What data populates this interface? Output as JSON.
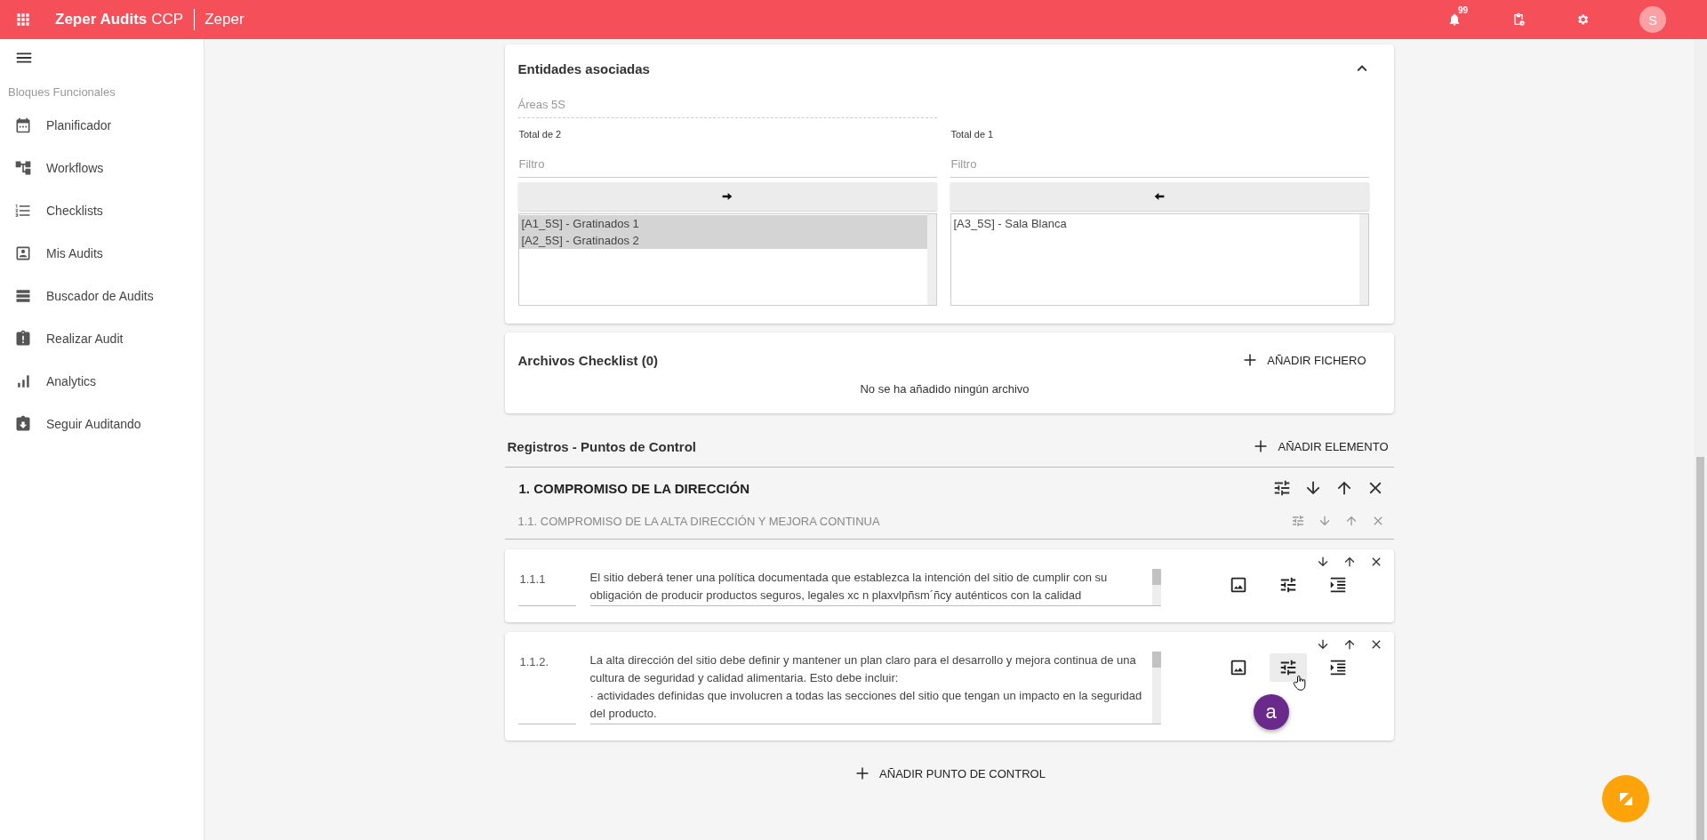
{
  "app_bar": {
    "title": "Zeper Audits",
    "title_suffix": "CCP",
    "org": "Zeper",
    "notification_count": "99",
    "avatar_initial": "S"
  },
  "sidebar": {
    "section_title": "Bloques Funcionales",
    "items": [
      {
        "label": "Planificador"
      },
      {
        "label": "Workflows"
      },
      {
        "label": "Checklists"
      },
      {
        "label": "Mis Audits"
      },
      {
        "label": "Buscador de Audits"
      },
      {
        "label": "Realizar Audit"
      },
      {
        "label": "Analytics"
      },
      {
        "label": "Seguir Auditando"
      }
    ]
  },
  "associated_entities": {
    "title": "Entidades asociadas",
    "expanded": true,
    "field_label": "Áreas 5S",
    "source": {
      "total": "Total de 2",
      "filter_placeholder": "Filtro",
      "items": [
        {
          "label": "[A1_5S] - Gratinados 1",
          "selected": true
        },
        {
          "label": "[A2_5S] - Gratinados 2",
          "selected": true
        }
      ]
    },
    "target": {
      "total": "Total de 1",
      "filter_placeholder": "Filtro",
      "items": [
        {
          "label": "[A3_5S] - Sala Blanca",
          "selected": false
        }
      ]
    }
  },
  "files": {
    "title": "Archivos Checklist (0)",
    "add_button": "AÑADIR FICHERO",
    "empty_message": "No se ha añadido ningún archivo"
  },
  "records": {
    "title": "Registros - Puntos de Control",
    "add_button": "AÑADIR ELEMENTO",
    "sections": [
      {
        "title": "1. COMPROMISO DE LA DIRECCIÓN",
        "subsections": [
          {
            "title": "1.1. COMPROMISO DE LA ALTA DIRECCIÓN Y MEJORA CONTINUA"
          }
        ]
      }
    ],
    "control_points": [
      {
        "code": "1.1.1",
        "text": "El sitio deberá tener una política documentada que establezca la intención del sitio de cumplir con su\nobligación de producir productos seguros, legales xc n plaxvlpñsm´ñcy auténticos con la calidad",
        "tune_hovered": false
      },
      {
        "code": "1.1.2.",
        "text": "La alta dirección del sitio debe definir y mantener un plan claro para el desarrollo y mejora continua de una\ncultura de seguridad y calidad alimentaria. Esto debe incluir:\n· actividades definidas que involucren a todas las secciones del sitio que tengan un impacto en la seguridad\ndel producto.",
        "tune_hovered": true
      }
    ],
    "add_control_point": "AÑADIR PUNTO DE CONTROL"
  },
  "marker": {
    "label": "a"
  }
}
